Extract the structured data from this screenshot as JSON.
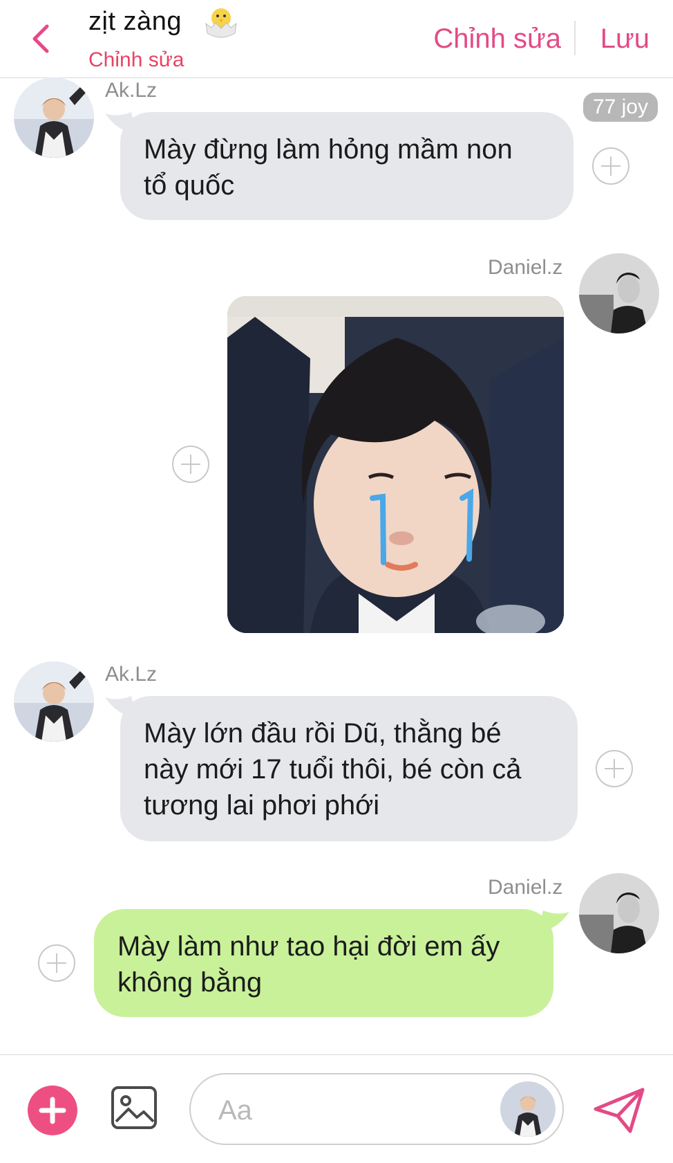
{
  "header": {
    "title": "zịt zàng",
    "subtitle": "Chỉnh sửa",
    "edit_label": "Chỉnh sửa",
    "save_label": "Lưu",
    "emoji_icon": "hatching-chick-icon"
  },
  "colors": {
    "accent": "#e34a86",
    "subtitle": "#e94363",
    "gray_bubble": "#e6e7eb",
    "green_bubble": "#c8f199",
    "add_button": "#ee4f82",
    "sticker_tears": "#4aa7e8"
  },
  "messages": [
    {
      "sender": "Ak.Lz",
      "side": "left",
      "type": "text",
      "text_lines": [
        "Mày đừng làm hỏng mầm non",
        "tổ quốc"
      ],
      "reaction": "77 joy"
    },
    {
      "sender": "Daniel.z",
      "side": "right",
      "type": "image"
    },
    {
      "sender": "Ak.Lz",
      "side": "left",
      "type": "text",
      "text_lines": [
        "Mày lớn đầu rồi Dũ, thằng bé",
        "này mới 17 tuổi thôi, bé còn cả",
        "tương lai phơi phới"
      ]
    },
    {
      "sender": "Daniel.z",
      "side": "right",
      "type": "text",
      "text_lines": [
        "Mày làm như tao hại đời em ấy",
        "không bằng"
      ]
    }
  ],
  "composer": {
    "placeholder": "Aa",
    "icons": [
      "plus-icon",
      "image-icon",
      "send-icon"
    ]
  }
}
